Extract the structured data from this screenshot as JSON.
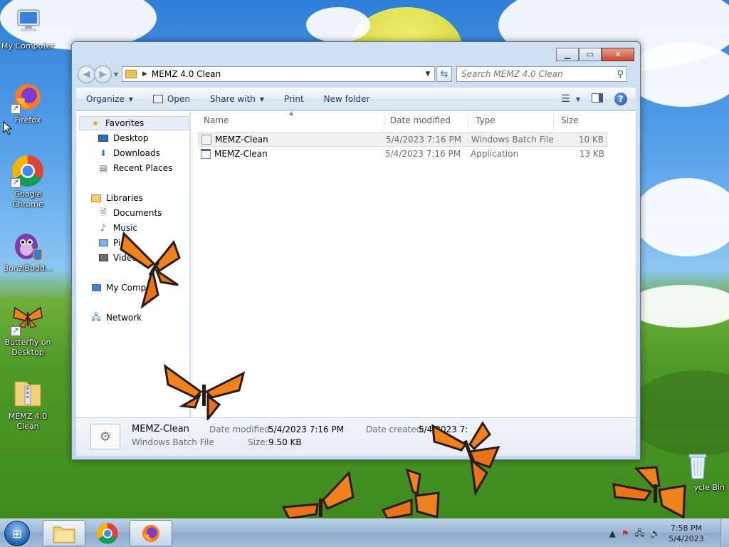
{
  "desktop": {
    "icons": [
      {
        "label": "My Computer",
        "icon": "computer-icon"
      },
      {
        "label": "Firefox",
        "icon": "firefox-icon"
      },
      {
        "label": "Google Chrome",
        "icon": "chrome-icon"
      },
      {
        "label": "BonziBudd...",
        "icon": "bonzibuddy-icon"
      },
      {
        "label": "Butterfly on Desktop",
        "icon": "butterfly-icon"
      },
      {
        "label": "MEMZ 4.0 Clean",
        "icon": "zip-folder-icon"
      },
      {
        "label": "ycle Bin",
        "icon": "recycle-bin-icon"
      }
    ]
  },
  "explorer": {
    "address": {
      "crumb": "MEMZ 4.0 Clean"
    },
    "search": {
      "placeholder": "Search MEMZ 4.0 Clean"
    },
    "toolbar": {
      "organize": "Organize",
      "open": "Open",
      "share_with": "Share with",
      "print": "Print",
      "new_folder": "New folder"
    },
    "nav": {
      "favorites": "Favorites",
      "desktop": "Desktop",
      "downloads": "Downloads",
      "recent_places": "Recent Places",
      "libraries": "Libraries",
      "documents": "Documents",
      "music": "Music",
      "pictures": "Pic",
      "videos": "Videos",
      "my_computer": "My Comp",
      "network": "Network"
    },
    "columns": {
      "name": "Name",
      "date_modified": "Date modified",
      "type": "Type",
      "size": "Size"
    },
    "files": [
      {
        "name": "MEMZ-Clean",
        "date": "5/4/2023 7:16 PM",
        "type": "Windows Batch File",
        "size": "10 KB"
      },
      {
        "name": "MEMZ-Clean",
        "date": "5/4/2023 7:16 PM",
        "type": "Application",
        "size": "13 KB"
      }
    ],
    "details": {
      "name": "MEMZ-Clean",
      "type": "Windows Batch File",
      "date_modified_label": "Date modified:",
      "date_modified_value": "5/4/2023 7:16 PM",
      "size_label": "Size:",
      "size_value": "9.50 KB",
      "date_created_label": "Date created:",
      "date_created_value": "5/4/2023 7:"
    }
  },
  "taskbar": {
    "clock_time": "7:58 PM",
    "clock_date": "5/4/2023"
  },
  "colors": {
    "butterfly_orange": "#f0821e",
    "butterfly_dark": "#2a1a10",
    "sky": "#5aa3ea",
    "grass": "#4f9a28"
  }
}
